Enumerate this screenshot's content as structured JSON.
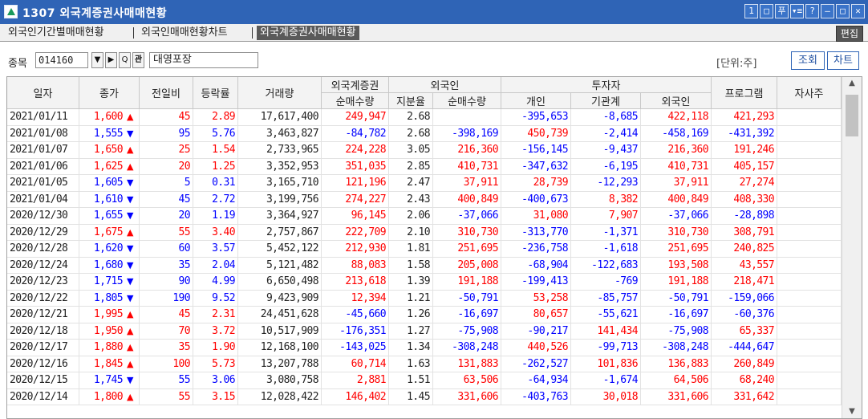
{
  "window": {
    "title": "1307 외국계증권사매매현황",
    "buttons": [
      "1",
      "□",
      "푸",
      "▾≡",
      "?",
      "—",
      "□",
      "✕"
    ]
  },
  "tabs": [
    "외국인기간별매매현황",
    "외국인매매현황차트",
    "외국계증권사매매현황"
  ],
  "active_tab": 2,
  "edit_label": "편집",
  "toolbar": {
    "item_label": "종목",
    "code_value": "014160",
    "name_value": "대영포장",
    "unit_label": "[단위:주]",
    "query_label": "조회",
    "chart_label": "차트",
    "btn_down": "▼",
    "btn_right": "▶",
    "btn_search": "Q",
    "btn_gwan": "관"
  },
  "columns": {
    "date": "일자",
    "close": "종가",
    "change": "전일비",
    "rate": "등락률",
    "volume": "거래량",
    "foreign_broker": "외국계증권",
    "foreign_broker_net": "순매수량",
    "foreign": "외국인",
    "holding_ratio": "지분율",
    "foreign_net": "순매수량",
    "investor": "투자자",
    "individual": "개인",
    "institution": "기관계",
    "investor_foreign": "외국인",
    "program": "프로그램",
    "treasury": "자사주"
  },
  "colors": {
    "up": "#ff0000",
    "down": "#0000ff",
    "title_bar": "#2f64b6"
  },
  "rows": [
    {
      "date": "2021/01/11",
      "close": "1,600",
      "dir": "up",
      "change": "45",
      "rate": "2.89",
      "volume": "17,617,400",
      "broker_net": "249,947",
      "holding": "2.68",
      "foreign_net": "",
      "individual": "-395,653",
      "institution": "-8,685",
      "inv_foreign": "422,118",
      "program": "421,293",
      "treasury": ""
    },
    {
      "date": "2021/01/08",
      "close": "1,555",
      "dir": "down",
      "change": "95",
      "rate": "5.76",
      "volume": "3,463,827",
      "broker_net": "-84,782",
      "holding": "2.68",
      "foreign_net": "-398,169",
      "individual": "450,739",
      "institution": "-2,414",
      "inv_foreign": "-458,169",
      "program": "-431,392",
      "treasury": ""
    },
    {
      "date": "2021/01/07",
      "close": "1,650",
      "dir": "up",
      "change": "25",
      "rate": "1.54",
      "volume": "2,733,965",
      "broker_net": "224,228",
      "holding": "3.05",
      "foreign_net": "216,360",
      "individual": "-156,145",
      "institution": "-9,437",
      "inv_foreign": "216,360",
      "program": "191,246",
      "treasury": ""
    },
    {
      "date": "2021/01/06",
      "close": "1,625",
      "dir": "up",
      "change": "20",
      "rate": "1.25",
      "volume": "3,352,953",
      "broker_net": "351,035",
      "holding": "2.85",
      "foreign_net": "410,731",
      "individual": "-347,632",
      "institution": "-6,195",
      "inv_foreign": "410,731",
      "program": "405,157",
      "treasury": ""
    },
    {
      "date": "2021/01/05",
      "close": "1,605",
      "dir": "down",
      "change": "5",
      "rate": "0.31",
      "volume": "3,165,710",
      "broker_net": "121,196",
      "holding": "2.47",
      "foreign_net": "37,911",
      "individual": "28,739",
      "institution": "-12,293",
      "inv_foreign": "37,911",
      "program": "27,274",
      "treasury": ""
    },
    {
      "date": "2021/01/04",
      "close": "1,610",
      "dir": "down",
      "change": "45",
      "rate": "2.72",
      "volume": "3,199,756",
      "broker_net": "274,227",
      "holding": "2.43",
      "foreign_net": "400,849",
      "individual": "-400,673",
      "institution": "8,382",
      "inv_foreign": "400,849",
      "program": "408,330",
      "treasury": ""
    },
    {
      "date": "2020/12/30",
      "close": "1,655",
      "dir": "down",
      "change": "20",
      "rate": "1.19",
      "volume": "3,364,927",
      "broker_net": "96,145",
      "holding": "2.06",
      "foreign_net": "-37,066",
      "individual": "31,080",
      "institution": "7,907",
      "inv_foreign": "-37,066",
      "program": "-28,898",
      "treasury": ""
    },
    {
      "date": "2020/12/29",
      "close": "1,675",
      "dir": "up",
      "change": "55",
      "rate": "3.40",
      "volume": "2,757,867",
      "broker_net": "222,709",
      "holding": "2.10",
      "foreign_net": "310,730",
      "individual": "-313,770",
      "institution": "-1,371",
      "inv_foreign": "310,730",
      "program": "308,791",
      "treasury": ""
    },
    {
      "date": "2020/12/28",
      "close": "1,620",
      "dir": "down",
      "change": "60",
      "rate": "3.57",
      "volume": "5,452,122",
      "broker_net": "212,930",
      "holding": "1.81",
      "foreign_net": "251,695",
      "individual": "-236,758",
      "institution": "-1,618",
      "inv_foreign": "251,695",
      "program": "240,825",
      "treasury": ""
    },
    {
      "date": "2020/12/24",
      "close": "1,680",
      "dir": "down",
      "change": "35",
      "rate": "2.04",
      "volume": "5,121,482",
      "broker_net": "88,083",
      "holding": "1.58",
      "foreign_net": "205,008",
      "individual": "-68,904",
      "institution": "-122,683",
      "inv_foreign": "193,508",
      "program": "43,557",
      "treasury": ""
    },
    {
      "date": "2020/12/23",
      "close": "1,715",
      "dir": "down",
      "change": "90",
      "rate": "4.99",
      "volume": "6,650,498",
      "broker_net": "213,618",
      "holding": "1.39",
      "foreign_net": "191,188",
      "individual": "-199,413",
      "institution": "-769",
      "inv_foreign": "191,188",
      "program": "218,471",
      "treasury": ""
    },
    {
      "date": "2020/12/22",
      "close": "1,805",
      "dir": "down",
      "change": "190",
      "rate": "9.52",
      "volume": "9,423,909",
      "broker_net": "12,394",
      "holding": "1.21",
      "foreign_net": "-50,791",
      "individual": "53,258",
      "institution": "-85,757",
      "inv_foreign": "-50,791",
      "program": "-159,066",
      "treasury": ""
    },
    {
      "date": "2020/12/21",
      "close": "1,995",
      "dir": "up",
      "change": "45",
      "rate": "2.31",
      "volume": "24,451,628",
      "broker_net": "-45,660",
      "holding": "1.26",
      "foreign_net": "-16,697",
      "individual": "80,657",
      "institution": "-55,621",
      "inv_foreign": "-16,697",
      "program": "-60,376",
      "treasury": ""
    },
    {
      "date": "2020/12/18",
      "close": "1,950",
      "dir": "up",
      "change": "70",
      "rate": "3.72",
      "volume": "10,517,909",
      "broker_net": "-176,351",
      "holding": "1.27",
      "foreign_net": "-75,908",
      "individual": "-90,217",
      "institution": "141,434",
      "inv_foreign": "-75,908",
      "program": "65,337",
      "treasury": ""
    },
    {
      "date": "2020/12/17",
      "close": "1,880",
      "dir": "up",
      "change": "35",
      "rate": "1.90",
      "volume": "12,168,100",
      "broker_net": "-143,025",
      "holding": "1.34",
      "foreign_net": "-308,248",
      "individual": "440,526",
      "institution": "-99,713",
      "inv_foreign": "-308,248",
      "program": "-444,647",
      "treasury": ""
    },
    {
      "date": "2020/12/16",
      "close": "1,845",
      "dir": "up",
      "change": "100",
      "rate": "5.73",
      "volume": "13,207,788",
      "broker_net": "60,714",
      "holding": "1.63",
      "foreign_net": "131,883",
      "individual": "-262,527",
      "institution": "101,836",
      "inv_foreign": "136,883",
      "program": "260,849",
      "treasury": ""
    },
    {
      "date": "2020/12/15",
      "close": "1,745",
      "dir": "down",
      "change": "55",
      "rate": "3.06",
      "volume": "3,080,758",
      "broker_net": "2,881",
      "holding": "1.51",
      "foreign_net": "63,506",
      "individual": "-64,934",
      "institution": "-1,674",
      "inv_foreign": "64,506",
      "program": "68,240",
      "treasury": ""
    },
    {
      "date": "2020/12/14",
      "close": "1,800",
      "dir": "up",
      "change": "55",
      "rate": "3.15",
      "volume": "12,028,422",
      "broker_net": "146,402",
      "holding": "1.45",
      "foreign_net": "331,606",
      "individual": "-403,763",
      "institution": "30,018",
      "inv_foreign": "331,606",
      "program": "331,642",
      "treasury": ""
    }
  ]
}
